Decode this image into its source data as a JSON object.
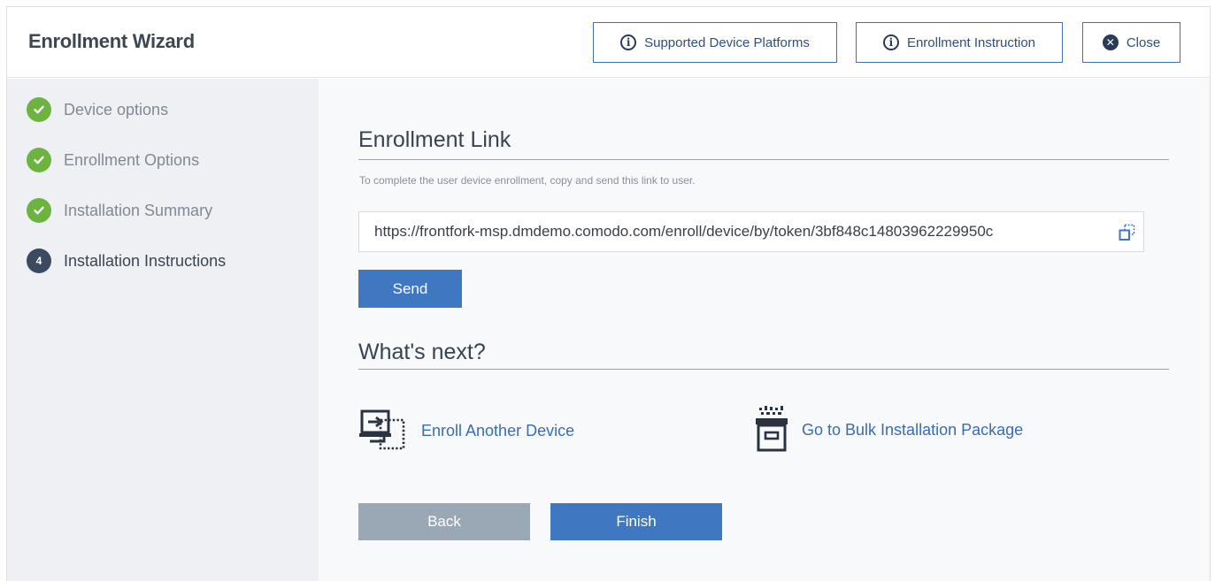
{
  "header": {
    "title": "Enrollment Wizard",
    "buttons": {
      "supported_platforms": "Supported Device Platforms",
      "enrollment_instruction": "Enrollment Instruction",
      "close": "Close"
    }
  },
  "sidebar": {
    "steps": [
      {
        "label": "Device options",
        "status": "done"
      },
      {
        "label": "Enrollment Options",
        "status": "done"
      },
      {
        "label": "Installation Summary",
        "status": "done"
      },
      {
        "label": "Installation Instructions",
        "status": "current",
        "number": "4"
      }
    ]
  },
  "main": {
    "enrollment_link_title": "Enrollment Link",
    "hint": "To complete the user device enrollment, copy and send this link to user.",
    "link_value": "https://frontfork-msp.dmdemo.comodo.com/enroll/device/by/token/3bf848c14803962229950c",
    "send_label": "Send",
    "whats_next_title": "What's next?",
    "enroll_another_label": "Enroll Another Device",
    "bulk_install_label": "Go to Bulk Installation Package",
    "back_label": "Back",
    "finish_label": "Finish"
  },
  "colors": {
    "accent": "#3f78c0",
    "done_green": "#6cb33f",
    "disabled_gray": "#9aa7b4"
  },
  "icons": {
    "info": "info-circle-icon",
    "close": "close-circle-icon",
    "check": "check-icon",
    "copy": "copy-icon",
    "enroll_device": "enroll-device-icon",
    "bulk_package": "bulk-package-icon"
  }
}
